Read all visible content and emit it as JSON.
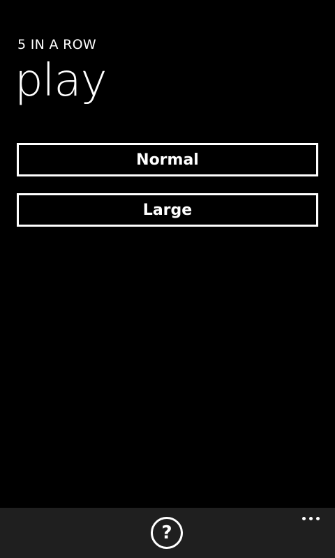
{
  "app": {
    "title": "5 IN A ROW",
    "page_title": "play"
  },
  "buttons": {
    "normal_label": "Normal",
    "large_label": "Large"
  },
  "appbar": {
    "help_glyph": "?",
    "help_icon": "question-circle-icon",
    "more_icon": "ellipsis-icon"
  },
  "colors": {
    "background": "#000000",
    "foreground": "#ffffff",
    "appbar_background": "#1f1f1f"
  }
}
